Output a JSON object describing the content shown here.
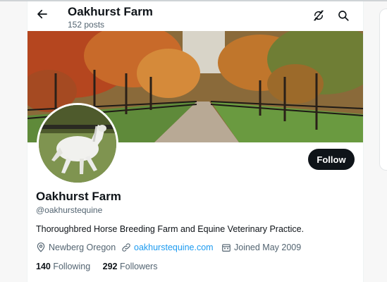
{
  "header": {
    "title": "Oakhurst Farm",
    "post_count": "152 posts"
  },
  "icons": {
    "back": "arrow-left-icon",
    "refresh": "refresh-off-icon",
    "search": "search-icon",
    "location": "location-pin-icon",
    "link": "link-icon",
    "calendar": "calendar-icon"
  },
  "images": {
    "banner": "Tree-lined farm lane with autumn foliage and black fences",
    "avatar": "White horse galloping in a green pasture"
  },
  "profile": {
    "name": "Oakhurst Farm",
    "handle": "@oakhurstequine",
    "bio": "Thoroughbred Horse Breeding Farm and Equine Veterinary Practice.",
    "location": "Newberg Oregon",
    "website": "oakhurstequine.com",
    "joined": "Joined May 2009",
    "following_count": "140",
    "following_label": "Following",
    "followers_count": "292",
    "followers_label": "Followers"
  },
  "actions": {
    "follow_label": "Follow"
  },
  "colors": {
    "accent": "#1d9bf0",
    "text": "#0f1419",
    "secondary": "#536471",
    "button": "#0f1419"
  }
}
